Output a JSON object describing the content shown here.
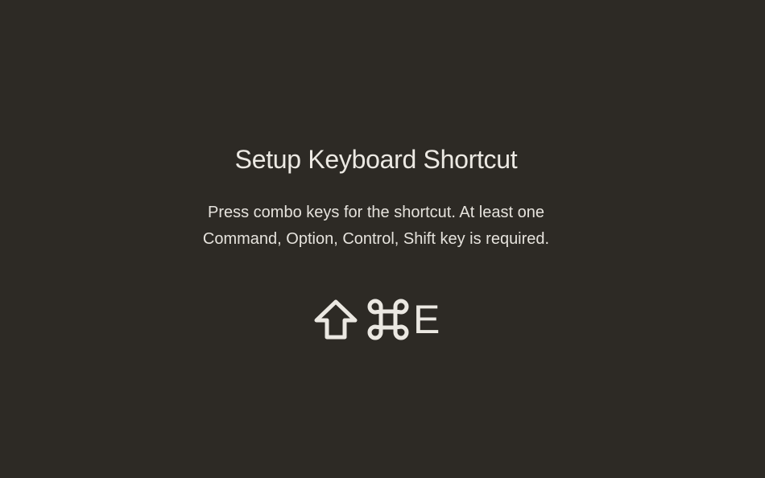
{
  "shortcut_setup": {
    "title": "Setup Keyboard Shortcut",
    "description_line1": "Press combo keys for the shortcut. At least one",
    "description_line2": "Command, Option, Control, Shift key is required.",
    "keys": [
      {
        "icon": "shift-icon"
      },
      {
        "icon": "command-icon"
      },
      {
        "label": "E"
      }
    ]
  },
  "colors": {
    "background": "#2d2a25",
    "text": "#ebe8e2"
  }
}
